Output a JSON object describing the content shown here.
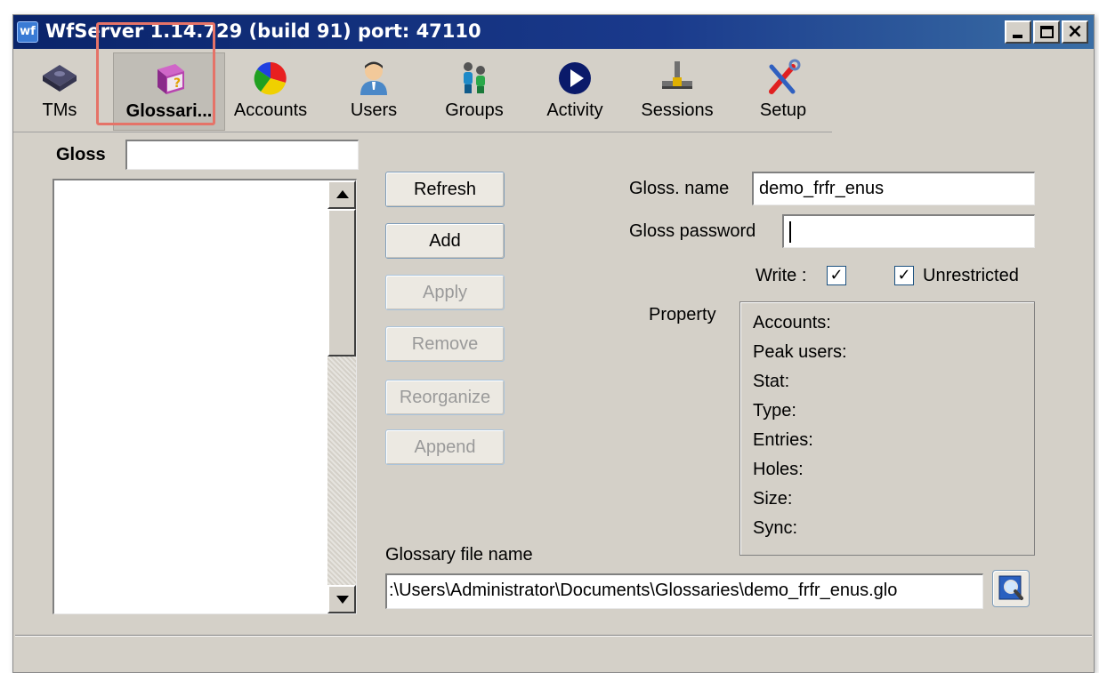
{
  "window": {
    "title": "WfServer 1.14.729 (build 91)  port: 47110",
    "icon_text": "wf"
  },
  "toolbar": {
    "items": [
      {
        "label": "TMs",
        "icon": "tm-disk-icon"
      },
      {
        "label": "Glossari...",
        "icon": "glossary-book-icon",
        "selected": true
      },
      {
        "label": "Accounts",
        "icon": "accounts-pie-icon"
      },
      {
        "label": "Users",
        "icon": "user-person-icon"
      },
      {
        "label": "Groups",
        "icon": "group-people-icon"
      },
      {
        "label": "Activity",
        "icon": "activity-play-icon"
      },
      {
        "label": "Sessions",
        "icon": "sessions-connector-icon"
      },
      {
        "label": "Setup",
        "icon": "setup-tools-icon"
      }
    ]
  },
  "left_panel": {
    "gloss_label": "Gloss",
    "gloss_value": ""
  },
  "buttons": {
    "refresh": "Refresh",
    "add": "Add",
    "apply": "Apply",
    "remove": "Remove",
    "reorganize": "Reorganize",
    "append": "Append"
  },
  "form": {
    "gloss_name_label": "Gloss. name",
    "gloss_name_value": "demo_frfr_enus",
    "gloss_password_label": "Gloss password",
    "gloss_password_value": "",
    "write_label": "Write :",
    "write_checked": true,
    "unrestricted_label": "Unrestricted",
    "unrestricted_checked": true,
    "property_label": "Property",
    "properties": [
      "Accounts:",
      "Peak users:",
      "Stat:",
      "Type:",
      "Entries:",
      "Holes:",
      "Size:",
      "Sync:"
    ],
    "file_label": "Glossary file name",
    "file_value": ":\\Users\\Administrator\\Documents\\Glossaries\\demo_frfr_enus.glo"
  },
  "colors": {
    "title_bar": "#0a246a",
    "window_face": "#d4d0c8",
    "highlight_box": "#e57368"
  }
}
